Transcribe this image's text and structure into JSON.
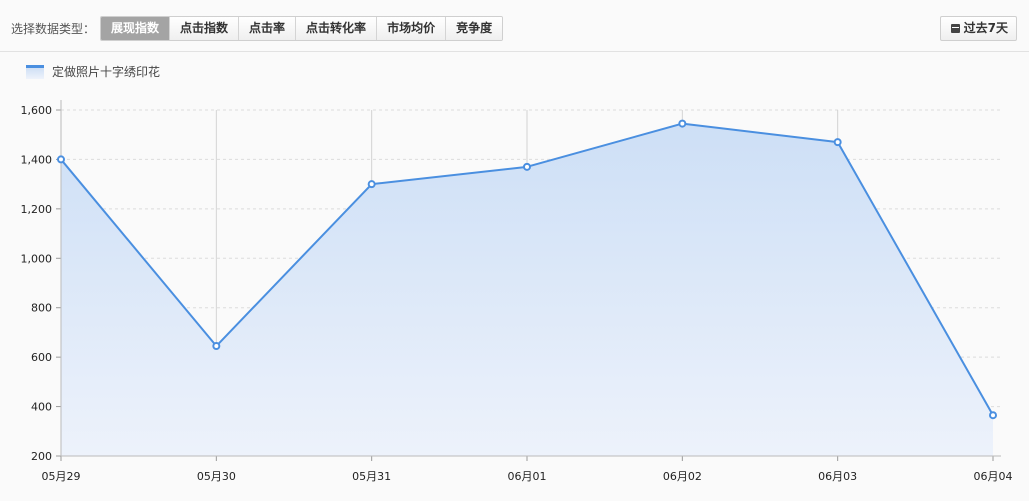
{
  "toolbar": {
    "type_label": "选择数据类型：",
    "tabs": [
      {
        "label": "展现指数",
        "active": true
      },
      {
        "label": "点击指数",
        "active": false
      },
      {
        "label": "点击率",
        "active": false
      },
      {
        "label": "点击转化率",
        "active": false
      },
      {
        "label": "市场均价",
        "active": false
      },
      {
        "label": "竞争度",
        "active": false
      }
    ],
    "range_label": "过去7天",
    "range_icon": "calendar-icon"
  },
  "colors": {
    "line": "#4a8fe0",
    "area_top": "#cddff6",
    "area_bottom": "#edf2fb",
    "active_tab": "#a4a4a4"
  },
  "chart_data": {
    "type": "area",
    "categories": [
      "05月29",
      "05月30",
      "05月31",
      "06月01",
      "06月02",
      "06月03",
      "06月04"
    ],
    "series": [
      {
        "name": "定做照片十字绣印花",
        "values": [
          1400,
          645,
          1300,
          1370,
          1545,
          1470,
          365
        ]
      }
    ],
    "ylim": [
      200,
      1600
    ],
    "yticks": [
      200,
      400,
      600,
      800,
      1000,
      1200,
      1400,
      1600
    ],
    "ytick_labels": [
      "200",
      "400",
      "600",
      "800",
      "1,000",
      "1,200",
      "1,400",
      "1,600"
    ],
    "grid": true,
    "legend": "top-left",
    "title": "",
    "xlabel": "",
    "ylabel": ""
  }
}
